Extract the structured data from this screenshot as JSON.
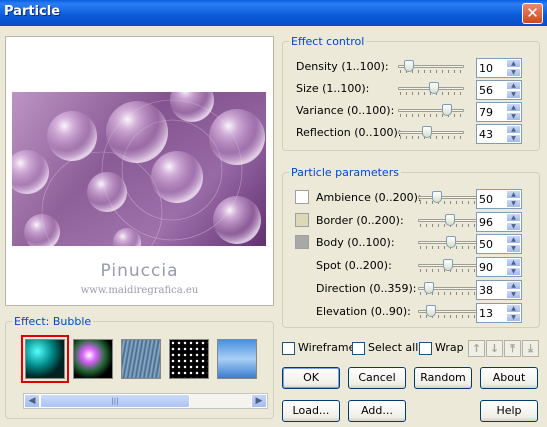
{
  "window": {
    "title": "Particle",
    "close_glyph": "✕"
  },
  "preview": {
    "watermark_name": "Pinuccia",
    "watermark_url": "www.maidiregrafica.eu"
  },
  "effect": {
    "group_label": "Effect: Bubble",
    "thumbnails": [
      "bubble-effect",
      "sparkle-effect",
      "rain-effect",
      "snow-effect",
      "cloud-effect"
    ],
    "selected_index": 0
  },
  "effect_control": {
    "group_label": "Effect control",
    "rows": [
      {
        "label": "Density (1..100):",
        "value": "10",
        "level": 0.1
      },
      {
        "label": "Size (1..100):",
        "value": "56",
        "level": 0.56
      },
      {
        "label": "Variance (0..100):",
        "value": "79",
        "level": 0.79
      },
      {
        "label": "Reflection (0..100):",
        "value": "43",
        "level": 0.43
      }
    ]
  },
  "particle_parameters": {
    "group_label": "Particle parameters",
    "rows": [
      {
        "label": "Ambience (0..200):",
        "value": "50",
        "level": 0.25,
        "swatch": "#ffffff"
      },
      {
        "label": "Border (0..200):",
        "value": "96",
        "level": 0.48,
        "swatch": "#dcd9b8"
      },
      {
        "label": "Body (0..100):",
        "value": "50",
        "level": 0.5,
        "swatch": "#a8a8a8"
      },
      {
        "label": "Spot (0..200):",
        "value": "90",
        "level": 0.45
      },
      {
        "label": "Direction (0..359):",
        "value": "38",
        "level": 0.11
      },
      {
        "label": "Elevation (0..90):",
        "value": "13",
        "level": 0.14
      }
    ]
  },
  "options": {
    "wireframe": "Wireframe",
    "select_all": "Select all",
    "wrap": "Wrap"
  },
  "buttons": {
    "ok": "OK",
    "cancel": "Cancel",
    "random": "Random",
    "about": "About",
    "load": "Load...",
    "add": "Add...",
    "help": "Help"
  },
  "arrows": [
    "↑",
    "↓",
    "⤒",
    "⤓"
  ],
  "scroll": {
    "left": "◀",
    "right": "▶",
    "grip": "|||"
  }
}
